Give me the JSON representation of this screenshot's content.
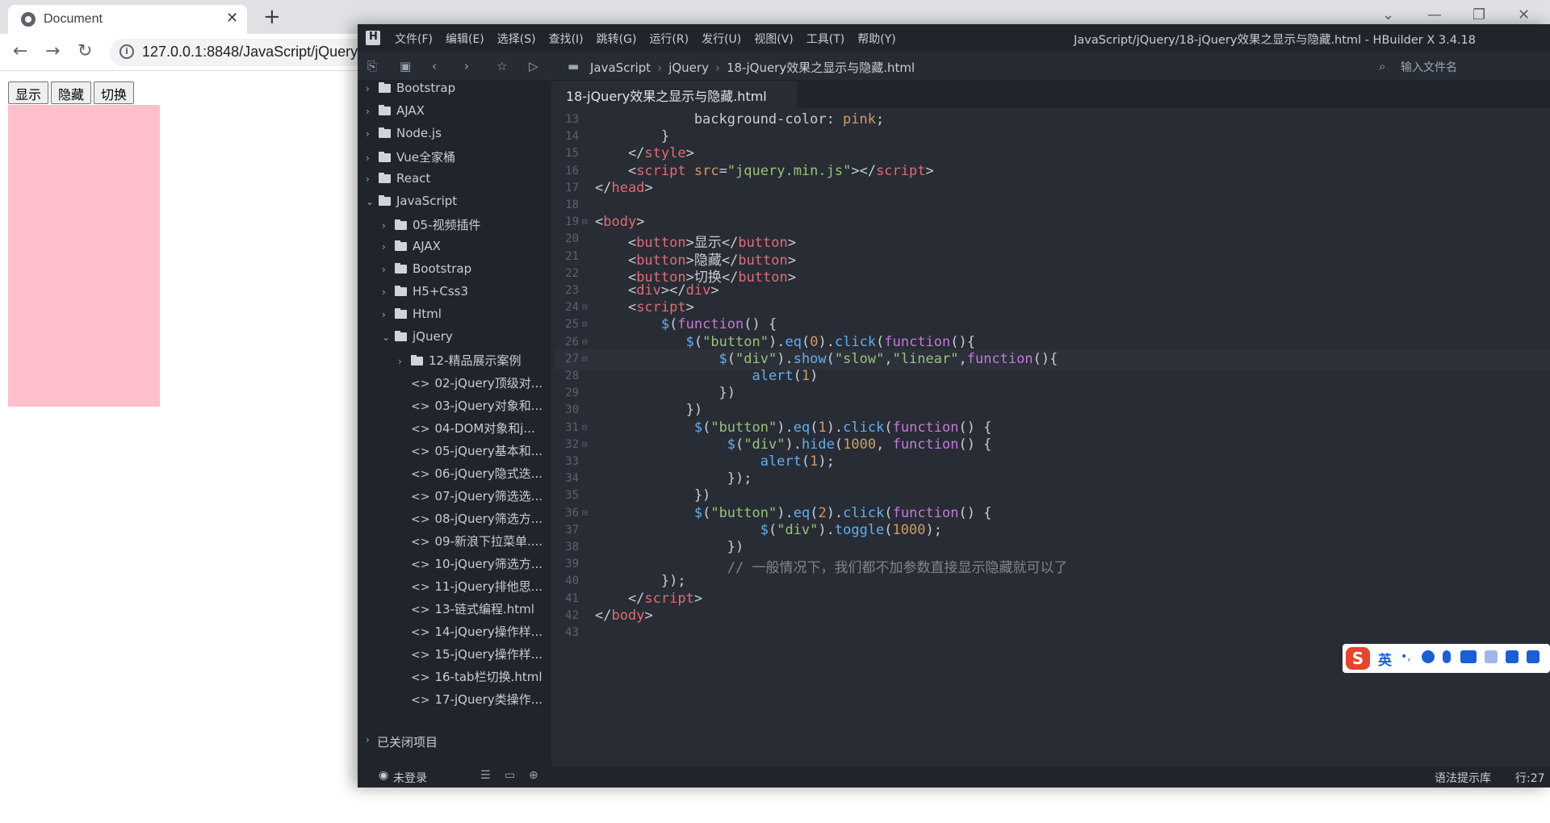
{
  "browser": {
    "tab_title": "Document",
    "url": "127.0.0.1:8848/JavaScript/jQuery",
    "page_buttons": [
      "显示",
      "隐藏",
      "切换"
    ],
    "box_color": "#ffc0cb"
  },
  "ide": {
    "menu": [
      "文件(F)",
      "编辑(E)",
      "选择(S)",
      "查找(I)",
      "跳转(G)",
      "运行(R)",
      "发行(U)",
      "视图(V)",
      "工具(T)",
      "帮助(Y)"
    ],
    "window_title": "JavaScript/jQuery/18-jQuery效果之显示与隐藏.html - HBuilder X 3.4.18",
    "breadcrumb": [
      "JavaScript",
      "jQuery",
      "18-jQuery效果之显示与隐藏.html"
    ],
    "file_search_placeholder": "输入文件名",
    "editor_tab": "18-jQuery效果之显示与隐藏.html",
    "tree": [
      {
        "label": "Bootstrap",
        "type": "folder",
        "depth": 0,
        "state": "collapsed"
      },
      {
        "label": "AJAX",
        "type": "folder",
        "depth": 0,
        "state": "collapsed"
      },
      {
        "label": "Node.js",
        "type": "folder",
        "depth": 0,
        "state": "collapsed"
      },
      {
        "label": "Vue全家桶",
        "type": "folder",
        "depth": 0,
        "state": "collapsed"
      },
      {
        "label": "React",
        "type": "folder",
        "depth": 0,
        "state": "collapsed"
      },
      {
        "label": "JavaScript",
        "type": "folder",
        "depth": 0,
        "state": "expanded"
      },
      {
        "label": "05-视频插件",
        "type": "folder",
        "depth": 1,
        "state": "collapsed"
      },
      {
        "label": "AJAX",
        "type": "folder",
        "depth": 1,
        "state": "collapsed"
      },
      {
        "label": "Bootstrap",
        "type": "folder",
        "depth": 1,
        "state": "collapsed"
      },
      {
        "label": "H5+Css3",
        "type": "folder",
        "depth": 1,
        "state": "collapsed"
      },
      {
        "label": "Html",
        "type": "folder",
        "depth": 1,
        "state": "collapsed"
      },
      {
        "label": "jQuery",
        "type": "folder",
        "depth": 1,
        "state": "expanded"
      },
      {
        "label": "12-精品展示案例",
        "type": "folder",
        "depth": 2,
        "state": "collapsed"
      },
      {
        "label": "02-jQuery顶级对...",
        "type": "file",
        "depth": 2
      },
      {
        "label": "03-jQuery对象和...",
        "type": "file",
        "depth": 2
      },
      {
        "label": "04-DOM对象和j...",
        "type": "file",
        "depth": 2
      },
      {
        "label": "05-jQuery基本和...",
        "type": "file",
        "depth": 2
      },
      {
        "label": "06-jQuery隐式迭...",
        "type": "file",
        "depth": 2
      },
      {
        "label": "07-jQuery筛选选...",
        "type": "file",
        "depth": 2
      },
      {
        "label": "08-jQuery筛选方...",
        "type": "file",
        "depth": 2
      },
      {
        "label": "09-新浪下拉菜单....",
        "type": "file",
        "depth": 2
      },
      {
        "label": "10-jQuery筛选方...",
        "type": "file",
        "depth": 2
      },
      {
        "label": "11-jQuery排他思...",
        "type": "file",
        "depth": 2
      },
      {
        "label": "13-链式编程.html",
        "type": "file",
        "depth": 2
      },
      {
        "label": "14-jQuery操作样...",
        "type": "file",
        "depth": 2
      },
      {
        "label": "15-jQuery操作样...",
        "type": "file",
        "depth": 2
      },
      {
        "label": "16-tab栏切换.html",
        "type": "file",
        "depth": 2
      },
      {
        "label": "17-jQuery类操作...",
        "type": "file",
        "depth": 2
      }
    ],
    "closed_projects": "已关闭项目",
    "login_status": "未登录",
    "status_right": [
      "语法提示库",
      "行:27"
    ],
    "code_lines": [
      {
        "n": "13",
        "fold": "",
        "tokens": [
          [
            "p",
            "            background-color: "
          ],
          [
            "a",
            "pink"
          ],
          [
            "p",
            ";"
          ]
        ]
      },
      {
        "n": "14",
        "fold": "",
        "tokens": [
          [
            "p",
            "        }"
          ]
        ]
      },
      {
        "n": "15",
        "fold": "",
        "tokens": [
          [
            "p",
            "    </"
          ],
          [
            "t",
            "style"
          ],
          [
            "p",
            ">"
          ]
        ]
      },
      {
        "n": "16",
        "fold": "",
        "tokens": [
          [
            "p",
            "    <"
          ],
          [
            "t",
            "script"
          ],
          [
            "n",
            " src"
          ],
          [
            "p",
            "="
          ],
          [
            "s",
            "\"jquery.min.js\""
          ],
          [
            "p",
            "></"
          ],
          [
            "t",
            "script"
          ],
          [
            "p",
            ">"
          ]
        ]
      },
      {
        "n": "17",
        "fold": "",
        "tokens": [
          [
            "p",
            "</"
          ],
          [
            "t",
            "head"
          ],
          [
            "p",
            ">"
          ]
        ]
      },
      {
        "n": "18",
        "fold": "",
        "tokens": []
      },
      {
        "n": "19",
        "fold": "⊟",
        "tokens": [
          [
            "p",
            "<"
          ],
          [
            "t",
            "body"
          ],
          [
            "p",
            ">"
          ]
        ]
      },
      {
        "n": "20",
        "fold": "",
        "tokens": [
          [
            "p",
            "    <"
          ],
          [
            "t",
            "button"
          ],
          [
            "p",
            ">显示</"
          ],
          [
            "t",
            "button"
          ],
          [
            "p",
            ">"
          ]
        ]
      },
      {
        "n": "21",
        "fold": "",
        "tokens": [
          [
            "p",
            "    <"
          ],
          [
            "t",
            "button"
          ],
          [
            "p",
            ">隐藏</"
          ],
          [
            "t",
            "button"
          ],
          [
            "p",
            ">"
          ]
        ]
      },
      {
        "n": "22",
        "fold": "",
        "tokens": [
          [
            "p",
            "    <"
          ],
          [
            "t",
            "button"
          ],
          [
            "p",
            ">切换</"
          ],
          [
            "t",
            "button"
          ],
          [
            "p",
            ">"
          ]
        ]
      },
      {
        "n": "23",
        "fold": "",
        "tokens": [
          [
            "p",
            "    <"
          ],
          [
            "t",
            "div"
          ],
          [
            "p",
            "></"
          ],
          [
            "t",
            "div"
          ],
          [
            "p",
            ">"
          ]
        ]
      },
      {
        "n": "24",
        "fold": "⊟",
        "tokens": [
          [
            "p",
            "    <"
          ],
          [
            "t",
            "script"
          ],
          [
            "p",
            ">"
          ]
        ]
      },
      {
        "n": "25",
        "fold": "⊟",
        "tokens": [
          [
            "p",
            "        "
          ],
          [
            "f",
            "$"
          ],
          [
            "p",
            "("
          ],
          [
            "k",
            "function"
          ],
          [
            "p",
            "() {"
          ]
        ]
      },
      {
        "n": "26",
        "fold": "⊟",
        "tokens": [
          [
            "p",
            "           "
          ],
          [
            "f",
            "$"
          ],
          [
            "p",
            "("
          ],
          [
            "s",
            "\"button\""
          ],
          [
            "p",
            ")."
          ],
          [
            "f",
            "eq"
          ],
          [
            "p",
            "("
          ],
          [
            "n",
            "0"
          ],
          [
            "p",
            ")."
          ],
          [
            "f",
            "click"
          ],
          [
            "p",
            "("
          ],
          [
            "k",
            "function"
          ],
          [
            "p",
            "(){"
          ]
        ]
      },
      {
        "n": "27",
        "fold": "⊟",
        "tokens": [
          [
            "p",
            "               "
          ],
          [
            "f",
            "$"
          ],
          [
            "p",
            "("
          ],
          [
            "s",
            "\"div\""
          ],
          [
            "p",
            ")."
          ],
          [
            "f",
            "show"
          ],
          [
            "p",
            "("
          ],
          [
            "s",
            "\"slow\""
          ],
          [
            "p",
            ","
          ],
          [
            "s",
            "\"linear\""
          ],
          [
            "p",
            ","
          ],
          [
            "k",
            "function"
          ],
          [
            "p",
            "(){"
          ]
        ]
      },
      {
        "n": "28",
        "fold": "",
        "tokens": [
          [
            "p",
            "                   "
          ],
          [
            "f",
            "alert"
          ],
          [
            "p",
            "("
          ],
          [
            "n",
            "1"
          ],
          [
            "p",
            ")"
          ]
        ]
      },
      {
        "n": "29",
        "fold": "",
        "tokens": [
          [
            "p",
            "               })"
          ]
        ]
      },
      {
        "n": "30",
        "fold": "",
        "tokens": [
          [
            "p",
            "           })"
          ]
        ]
      },
      {
        "n": "31",
        "fold": "⊟",
        "tokens": [
          [
            "p",
            "            "
          ],
          [
            "f",
            "$"
          ],
          [
            "p",
            "("
          ],
          [
            "s",
            "\"button\""
          ],
          [
            "p",
            ")."
          ],
          [
            "f",
            "eq"
          ],
          [
            "p",
            "("
          ],
          [
            "n",
            "1"
          ],
          [
            "p",
            ")."
          ],
          [
            "f",
            "click"
          ],
          [
            "p",
            "("
          ],
          [
            "k",
            "function"
          ],
          [
            "p",
            "() {"
          ]
        ]
      },
      {
        "n": "32",
        "fold": "⊟",
        "tokens": [
          [
            "p",
            "                "
          ],
          [
            "f",
            "$"
          ],
          [
            "p",
            "("
          ],
          [
            "s",
            "\"div\""
          ],
          [
            "p",
            ")."
          ],
          [
            "f",
            "hide"
          ],
          [
            "p",
            "("
          ],
          [
            "n",
            "1000"
          ],
          [
            "p",
            ", "
          ],
          [
            "k",
            "function"
          ],
          [
            "p",
            "() {"
          ]
        ]
      },
      {
        "n": "33",
        "fold": "",
        "tokens": [
          [
            "p",
            "                    "
          ],
          [
            "f",
            "alert"
          ],
          [
            "p",
            "("
          ],
          [
            "n",
            "1"
          ],
          [
            "p",
            ");"
          ]
        ]
      },
      {
        "n": "34",
        "fold": "",
        "tokens": [
          [
            "p",
            "                });"
          ]
        ]
      },
      {
        "n": "35",
        "fold": "",
        "tokens": [
          [
            "p",
            "            })"
          ]
        ]
      },
      {
        "n": "36",
        "fold": "⊟",
        "tokens": [
          [
            "p",
            "            "
          ],
          [
            "f",
            "$"
          ],
          [
            "p",
            "("
          ],
          [
            "s",
            "\"button\""
          ],
          [
            "p",
            ")."
          ],
          [
            "f",
            "eq"
          ],
          [
            "p",
            "("
          ],
          [
            "n",
            "2"
          ],
          [
            "p",
            ")."
          ],
          [
            "f",
            "click"
          ],
          [
            "p",
            "("
          ],
          [
            "k",
            "function"
          ],
          [
            "p",
            "() {"
          ]
        ]
      },
      {
        "n": "37",
        "fold": "",
        "tokens": [
          [
            "p",
            "                    "
          ],
          [
            "f",
            "$"
          ],
          [
            "p",
            "("
          ],
          [
            "s",
            "\"div\""
          ],
          [
            "p",
            ")."
          ],
          [
            "f",
            "toggle"
          ],
          [
            "p",
            "("
          ],
          [
            "n",
            "1000"
          ],
          [
            "p",
            ");"
          ]
        ]
      },
      {
        "n": "38",
        "fold": "",
        "tokens": [
          [
            "p",
            "                })"
          ]
        ]
      },
      {
        "n": "39",
        "fold": "",
        "tokens": [
          [
            "c",
            "                // 一般情况下，我们都不加参数直接显示隐藏就可以了"
          ]
        ]
      },
      {
        "n": "40",
        "fold": "",
        "tokens": [
          [
            "p",
            "        });"
          ]
        ]
      },
      {
        "n": "41",
        "fold": "",
        "tokens": [
          [
            "p",
            "    </"
          ],
          [
            "t",
            "script"
          ],
          [
            "p",
            ">"
          ]
        ]
      },
      {
        "n": "42",
        "fold": "",
        "tokens": [
          [
            "p",
            "</"
          ],
          [
            "t",
            "body"
          ],
          [
            "p",
            ">"
          ]
        ]
      },
      {
        "n": "43",
        "fold": "",
        "tokens": []
      }
    ],
    "current_line": "27"
  },
  "ime": {
    "language": "英"
  }
}
